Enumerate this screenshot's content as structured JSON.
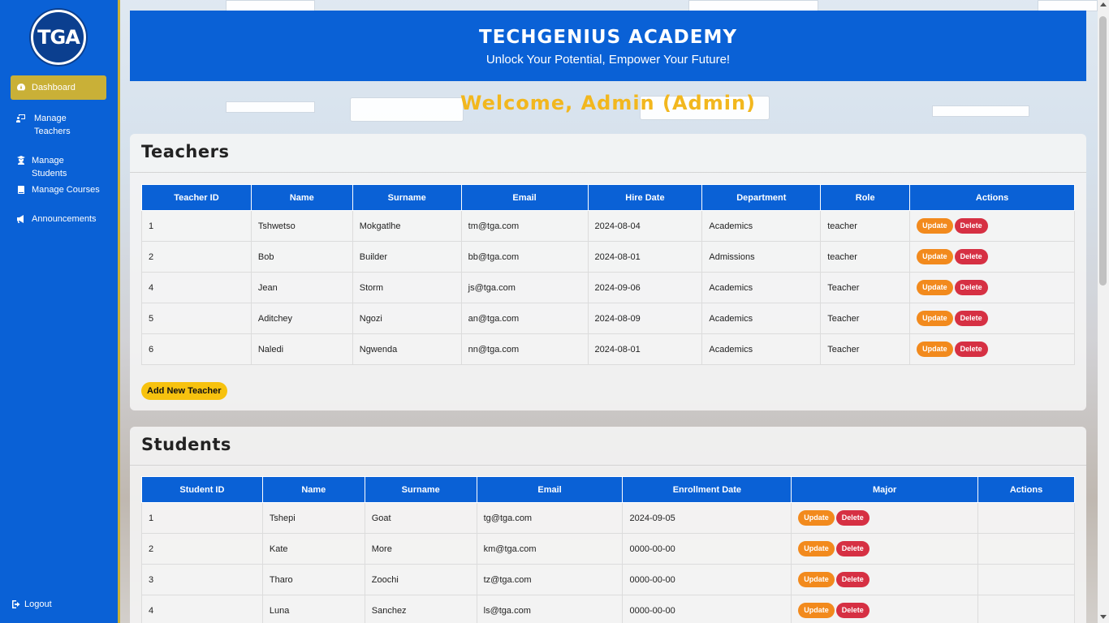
{
  "sidebar": {
    "logo_text": "TGA",
    "items": [
      {
        "label": "Dashboard",
        "icon": "dashboard-icon",
        "active": true
      },
      {
        "label": "Manage Teachers",
        "icon": "teacher-icon"
      },
      {
        "label": "Manage Students",
        "icon": "student-icon"
      },
      {
        "label": "Manage Courses",
        "icon": "book-icon"
      },
      {
        "label": "Announcements",
        "icon": "megaphone-icon"
      }
    ],
    "logout_label": "Logout"
  },
  "header": {
    "title": "TECHGENIUS ACADEMY",
    "subtitle": "Unlock Your Potential, Empower Your Future!"
  },
  "welcome": "Welcome, Admin (Admin)",
  "teachers": {
    "title": "Teachers",
    "columns": [
      "Teacher ID",
      "Name",
      "Surname",
      "Email",
      "Hire Date",
      "Department",
      "Role",
      "Actions"
    ],
    "rows": [
      [
        "1",
        "Tshwetso",
        "Mokgatlhe",
        "tm@tga.com",
        "2024-08-04",
        "Academics",
        "teacher"
      ],
      [
        "2",
        "Bob",
        "Builder",
        "bb@tga.com",
        "2024-08-01",
        "Admissions",
        "teacher"
      ],
      [
        "4",
        "Jean",
        "Storm",
        "js@tga.com",
        "2024-09-06",
        "Academics",
        "Teacher"
      ],
      [
        "5",
        "Aditchey",
        "Ngozi",
        "an@tga.com",
        "2024-08-09",
        "Academics",
        "Teacher"
      ],
      [
        "6",
        "Naledi",
        "Ngwenda",
        "nn@tga.com",
        "2024-08-01",
        "Academics",
        "Teacher"
      ]
    ],
    "update_label": "Update",
    "delete_label": "Delete",
    "add_label": "Add New Teacher"
  },
  "students": {
    "title": "Students",
    "columns": [
      "Student ID",
      "Name",
      "Surname",
      "Email",
      "Enrollment Date",
      "Major",
      "Actions"
    ],
    "rows": [
      [
        "1",
        "Tshepi",
        "Goat",
        "tg@tga.com",
        "2024-09-05"
      ],
      [
        "2",
        "Kate",
        "More",
        "km@tga.com",
        "0000-00-00"
      ],
      [
        "3",
        "Tharo",
        "Zoochi",
        "tz@tga.com",
        "0000-00-00"
      ],
      [
        "4",
        "Luna",
        "Sanchez",
        "ls@tga.com",
        "0000-00-00"
      ]
    ],
    "update_label": "Update",
    "delete_label": "Delete"
  },
  "colors": {
    "primary_blue": "#0a61d6",
    "gold": "#c9b037",
    "welcome_yellow": "#f2b71e",
    "update_orange": "#f28a1d",
    "delete_red": "#d63043",
    "add_yellow": "#f7c20f"
  }
}
